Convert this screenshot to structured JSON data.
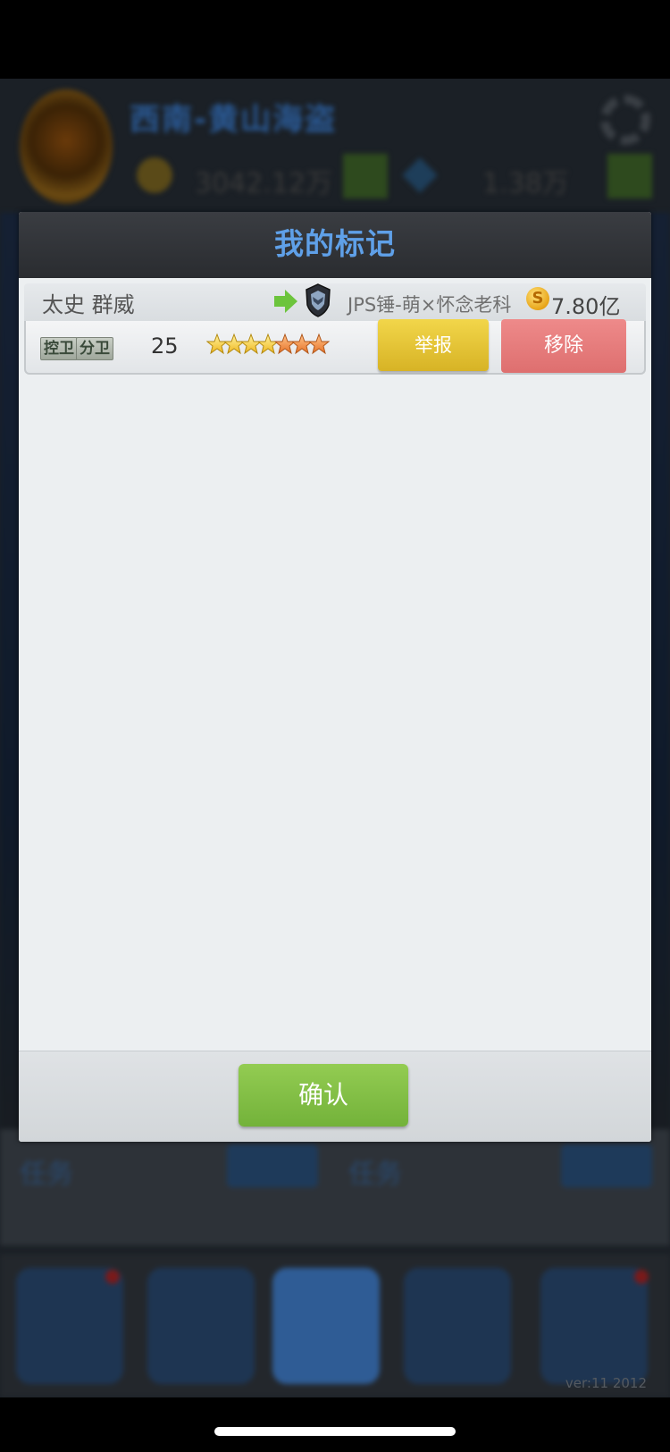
{
  "background": {
    "team_name": "西南-黄山海盗",
    "coins": "3042.12万",
    "gems": "1.38万",
    "task_label_1": "任务",
    "task_label_2": "任务",
    "version": "ver:11  2012"
  },
  "dialog": {
    "title": "我的标记",
    "player": {
      "name": "太史 群威",
      "club": "JPS锤-萌×怀念老科",
      "price": "7.80亿",
      "coin_symbol": "S",
      "positions": [
        "控卫",
        "分卫"
      ],
      "age": "25",
      "rating_stars": 7,
      "report_label": "举报",
      "remove_label": "移除"
    },
    "confirm_label": "确认"
  },
  "colors": {
    "title_blue": "#5fa0e8",
    "report_yellow": "#e5c43a",
    "remove_red": "#e57b7b",
    "confirm_green": "#84c046"
  }
}
